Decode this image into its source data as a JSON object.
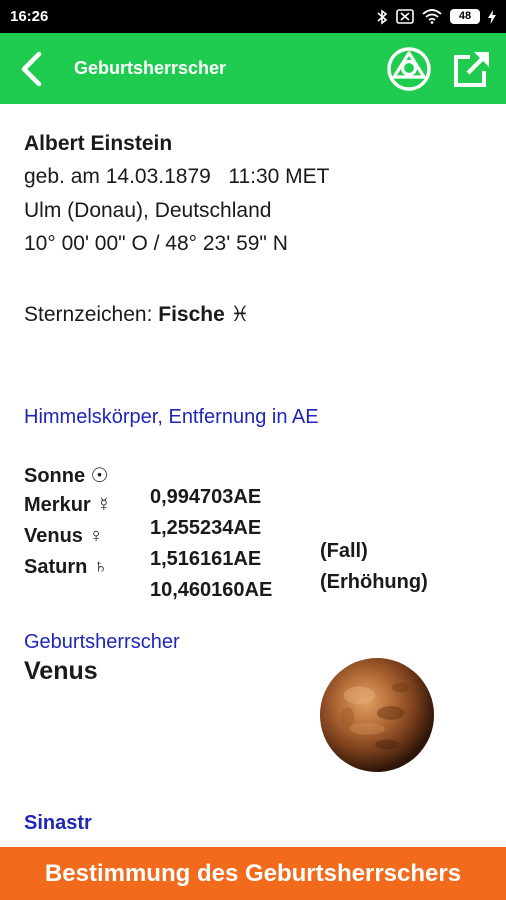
{
  "status": {
    "time": "16:26",
    "battery": "48"
  },
  "appbar": {
    "title": "Geburtsherrscher"
  },
  "person": {
    "name": "Albert Einstein",
    "birth": "geb. am 14.03.1879   11:30 MET",
    "place": "Ulm (Donau), Deutschland",
    "coords": "10° 00' 00\" O / 48° 23' 59\" N",
    "sign_prefix": "Sternzeichen: ",
    "sign": "Fische ♓"
  },
  "bodies": {
    "title": "Himmelskörper, Entfernung in AE",
    "rows": [
      {
        "name": "Sonne ☉",
        "distance": "0,994703AE",
        "note": ""
      },
      {
        "name": "Merkur ☿",
        "distance": "1,255234AE",
        "note": "(Fall)"
      },
      {
        "name": "Venus ♀",
        "distance": "1,516161AE",
        "note": "(Erhöhung)"
      },
      {
        "name": "Saturn ♄",
        "distance": "10,460160AE",
        "note": ""
      }
    ]
  },
  "ruler": {
    "title": "Geburtsherrscher",
    "name": "Venus"
  },
  "next_section": {
    "title": "Sinastr"
  },
  "banner": {
    "label": "Bestimmung des Geburtsherrschers"
  },
  "colors": {
    "appbar": "#1fcc4f",
    "section_title": "#1f26b8",
    "banner": "#f26b1c"
  }
}
